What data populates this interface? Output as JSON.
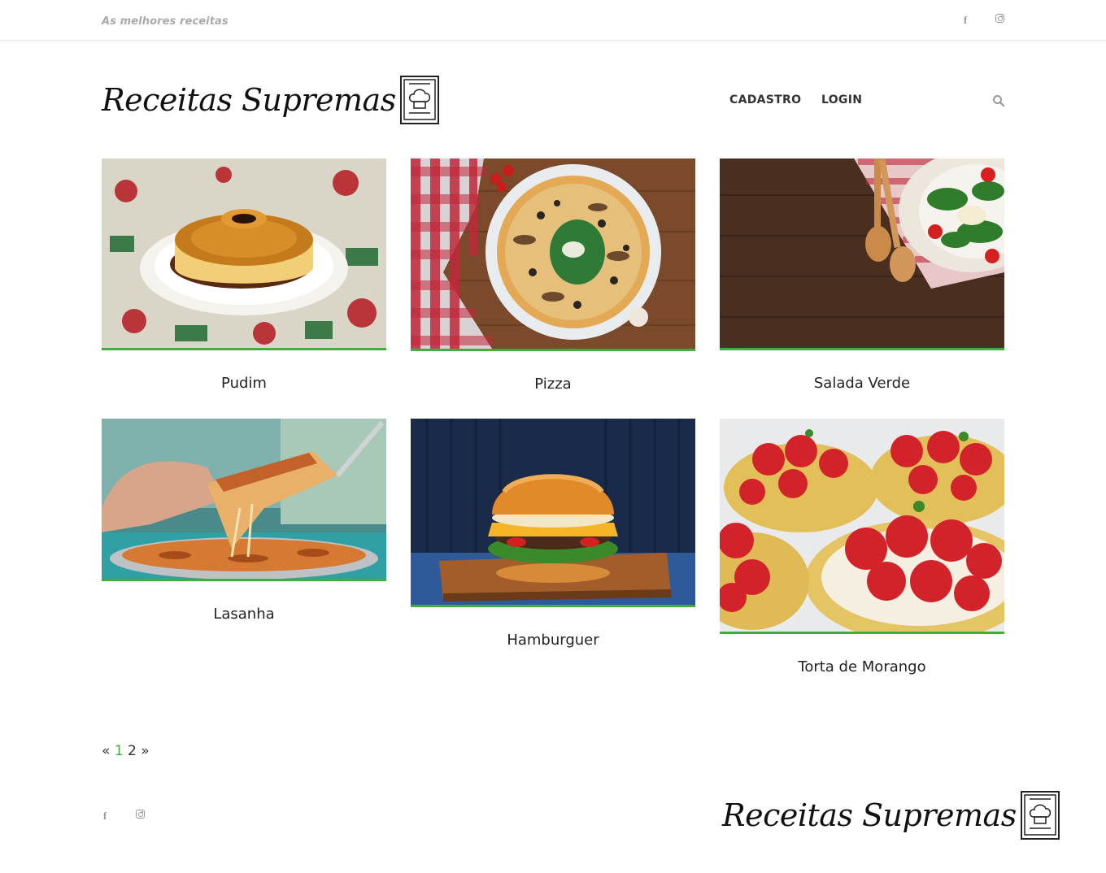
{
  "topbar": {
    "tagline": "As melhores receitas"
  },
  "social": {
    "facebook_glyph": "f",
    "icons": [
      "facebook-icon",
      "instagram-icon"
    ]
  },
  "header": {
    "logo_text": "Receitas Supremas",
    "nav": [
      {
        "label": "CADASTRO"
      },
      {
        "label": "LOGIN"
      }
    ]
  },
  "recipes": [
    {
      "title": "Pudim"
    },
    {
      "title": "Pizza"
    },
    {
      "title": "Salada Verde"
    },
    {
      "title": "Lasanha"
    },
    {
      "title": "Hamburguer"
    },
    {
      "title": "Torta de Morango"
    }
  ],
  "pagination": {
    "prev": "«",
    "pages": [
      "1",
      "2"
    ],
    "next": "»"
  },
  "footer": {
    "logo_text": "Receitas Supremas"
  },
  "colors": {
    "accent": "#3fae3f",
    "muted": "#aaaaaa",
    "text": "#222222"
  }
}
